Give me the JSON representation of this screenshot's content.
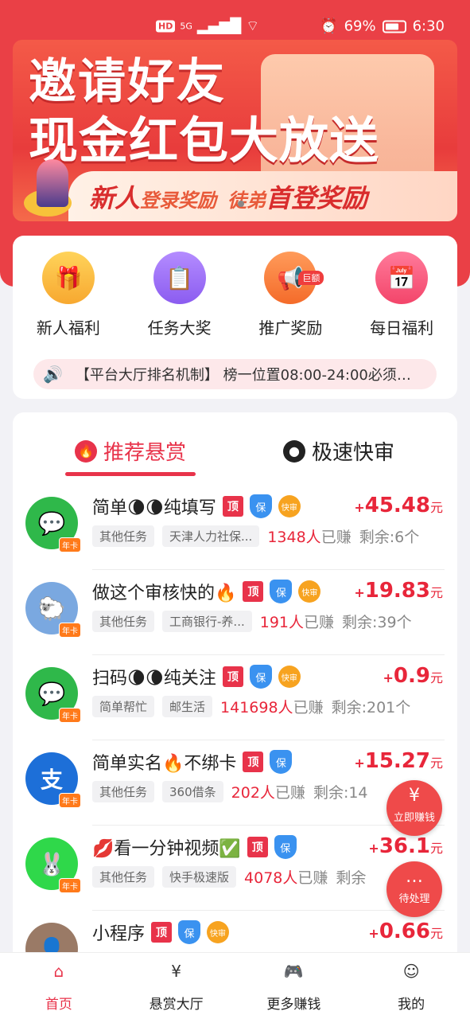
{
  "status_bar": {
    "hd": "HD",
    "network": "5G",
    "battery": "69%",
    "time": "6:30"
  },
  "banner": {
    "line1": "邀请好友",
    "line2": "现金红包大放送",
    "strip_a_big": "新人",
    "strip_a_small": "登录奖励",
    "strip_b_big": "徒弟",
    "strip_b_mid": "首登奖励"
  },
  "menu": {
    "items": [
      {
        "label": "新人福利",
        "icon": "gift-icon"
      },
      {
        "label": "任务大奖",
        "icon": "clipboard-icon"
      },
      {
        "label": "推广奖励",
        "icon": "megaphone-icon",
        "badge": "巨额"
      },
      {
        "label": "每日福利",
        "icon": "calendar-check-icon"
      }
    ],
    "notice": "【平台大厅排名机制】 榜一位置08:00-24:00必须…"
  },
  "tabs": [
    {
      "label": "推荐悬赏",
      "icon": "fire-icon"
    },
    {
      "label": "极速快审",
      "icon": "user-circle-icon"
    }
  ],
  "tags": {
    "ding": "顶",
    "bao": "保",
    "kuai": "快审",
    "nianka": "年卡",
    "earned_suffix": "已赚",
    "yuan": "元",
    "plus": "+"
  },
  "tasks": [
    {
      "title": "简单🌘🌘纯填写",
      "amount": "45.48",
      "chip1": "其他任务",
      "chip2": "天津人力社保...",
      "earned": "1348人",
      "remain": "剩余:6个",
      "avatar_color": "#2fb84a",
      "avatar_glyph": "💬",
      "tags": [
        "ding",
        "bao",
        "kuai"
      ]
    },
    {
      "title": "做这个审核快的🔥",
      "amount": "19.83",
      "chip1": "其他任务",
      "chip2": "工商银行-养...",
      "earned": "191人",
      "remain": "剩余:39个",
      "avatar_color": "#7aa8e0",
      "avatar_glyph": "🐑",
      "tags": [
        "ding",
        "bao",
        "kuai"
      ]
    },
    {
      "title": "扫码🌘🌘纯关注",
      "amount": "0.9",
      "chip1": "简单帮忙",
      "chip2": "邮生活",
      "earned": "141698人",
      "remain": "剩余:201个",
      "avatar_color": "#2fb84a",
      "avatar_glyph": "💬",
      "tags": [
        "ding",
        "bao",
        "kuai"
      ]
    },
    {
      "title": "简单实名🔥不绑卡",
      "amount": "15.27",
      "chip1": "其他任务",
      "chip2": "360借条",
      "earned": "202人",
      "remain": "剩余:14",
      "avatar_color": "#1d6fd8",
      "avatar_glyph": "支",
      "tags": [
        "ding",
        "bao"
      ]
    },
    {
      "title": "💋看一分钟视频✅",
      "amount": "36.1",
      "chip1": "其他任务",
      "chip2": "快手极速版",
      "earned": "4078人",
      "remain": "剩余",
      "avatar_color": "#2fd84a",
      "avatar_glyph": "🐰",
      "tags": [
        "ding",
        "bao"
      ]
    },
    {
      "title": "小程序",
      "amount": "0.66",
      "chip1": "",
      "chip2": "",
      "earned": "",
      "remain": "",
      "avatar_color": "#9a7a66",
      "avatar_glyph": "👤",
      "tags": [
        "ding",
        "bao",
        "kuai"
      ]
    }
  ],
  "fabs": [
    {
      "label": "立即赚钱",
      "icon": "yuan-icon"
    },
    {
      "label": "待处理",
      "icon": "chat-icon"
    }
  ],
  "bottom_nav": [
    {
      "label": "首页",
      "icon": "home-icon",
      "active": true
    },
    {
      "label": "悬赏大厅",
      "icon": "yuan-doc-icon"
    },
    {
      "label": "更多赚钱",
      "icon": "gamepad-icon"
    },
    {
      "label": "我的",
      "icon": "user-icon"
    }
  ],
  "colors": {
    "brand": "#ea4046",
    "accent": "#e8334a",
    "amount": "#e8263a"
  }
}
